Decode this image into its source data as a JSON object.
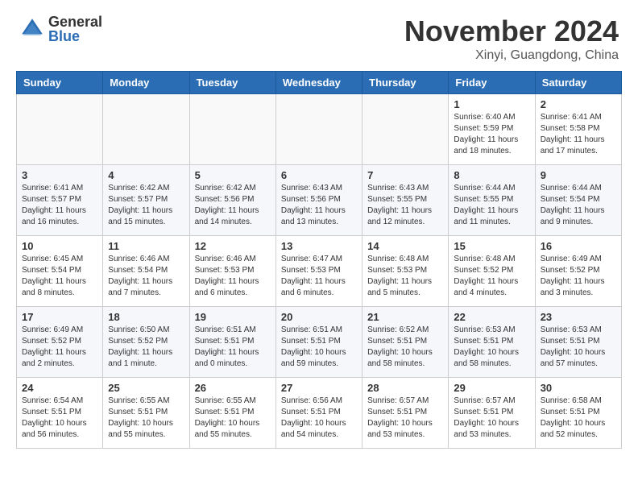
{
  "header": {
    "logo_general": "General",
    "logo_blue": "Blue",
    "month_title": "November 2024",
    "location": "Xinyi, Guangdong, China"
  },
  "weekdays": [
    "Sunday",
    "Monday",
    "Tuesday",
    "Wednesday",
    "Thursday",
    "Friday",
    "Saturday"
  ],
  "weeks": [
    [
      {
        "day": "",
        "info": ""
      },
      {
        "day": "",
        "info": ""
      },
      {
        "day": "",
        "info": ""
      },
      {
        "day": "",
        "info": ""
      },
      {
        "day": "",
        "info": ""
      },
      {
        "day": "1",
        "info": "Sunrise: 6:40 AM\nSunset: 5:59 PM\nDaylight: 11 hours and 18 minutes."
      },
      {
        "day": "2",
        "info": "Sunrise: 6:41 AM\nSunset: 5:58 PM\nDaylight: 11 hours and 17 minutes."
      }
    ],
    [
      {
        "day": "3",
        "info": "Sunrise: 6:41 AM\nSunset: 5:57 PM\nDaylight: 11 hours and 16 minutes."
      },
      {
        "day": "4",
        "info": "Sunrise: 6:42 AM\nSunset: 5:57 PM\nDaylight: 11 hours and 15 minutes."
      },
      {
        "day": "5",
        "info": "Sunrise: 6:42 AM\nSunset: 5:56 PM\nDaylight: 11 hours and 14 minutes."
      },
      {
        "day": "6",
        "info": "Sunrise: 6:43 AM\nSunset: 5:56 PM\nDaylight: 11 hours and 13 minutes."
      },
      {
        "day": "7",
        "info": "Sunrise: 6:43 AM\nSunset: 5:55 PM\nDaylight: 11 hours and 12 minutes."
      },
      {
        "day": "8",
        "info": "Sunrise: 6:44 AM\nSunset: 5:55 PM\nDaylight: 11 hours and 11 minutes."
      },
      {
        "day": "9",
        "info": "Sunrise: 6:44 AM\nSunset: 5:54 PM\nDaylight: 11 hours and 9 minutes."
      }
    ],
    [
      {
        "day": "10",
        "info": "Sunrise: 6:45 AM\nSunset: 5:54 PM\nDaylight: 11 hours and 8 minutes."
      },
      {
        "day": "11",
        "info": "Sunrise: 6:46 AM\nSunset: 5:54 PM\nDaylight: 11 hours and 7 minutes."
      },
      {
        "day": "12",
        "info": "Sunrise: 6:46 AM\nSunset: 5:53 PM\nDaylight: 11 hours and 6 minutes."
      },
      {
        "day": "13",
        "info": "Sunrise: 6:47 AM\nSunset: 5:53 PM\nDaylight: 11 hours and 6 minutes."
      },
      {
        "day": "14",
        "info": "Sunrise: 6:48 AM\nSunset: 5:53 PM\nDaylight: 11 hours and 5 minutes."
      },
      {
        "day": "15",
        "info": "Sunrise: 6:48 AM\nSunset: 5:52 PM\nDaylight: 11 hours and 4 minutes."
      },
      {
        "day": "16",
        "info": "Sunrise: 6:49 AM\nSunset: 5:52 PM\nDaylight: 11 hours and 3 minutes."
      }
    ],
    [
      {
        "day": "17",
        "info": "Sunrise: 6:49 AM\nSunset: 5:52 PM\nDaylight: 11 hours and 2 minutes."
      },
      {
        "day": "18",
        "info": "Sunrise: 6:50 AM\nSunset: 5:52 PM\nDaylight: 11 hours and 1 minute."
      },
      {
        "day": "19",
        "info": "Sunrise: 6:51 AM\nSunset: 5:51 PM\nDaylight: 11 hours and 0 minutes."
      },
      {
        "day": "20",
        "info": "Sunrise: 6:51 AM\nSunset: 5:51 PM\nDaylight: 10 hours and 59 minutes."
      },
      {
        "day": "21",
        "info": "Sunrise: 6:52 AM\nSunset: 5:51 PM\nDaylight: 10 hours and 58 minutes."
      },
      {
        "day": "22",
        "info": "Sunrise: 6:53 AM\nSunset: 5:51 PM\nDaylight: 10 hours and 58 minutes."
      },
      {
        "day": "23",
        "info": "Sunrise: 6:53 AM\nSunset: 5:51 PM\nDaylight: 10 hours and 57 minutes."
      }
    ],
    [
      {
        "day": "24",
        "info": "Sunrise: 6:54 AM\nSunset: 5:51 PM\nDaylight: 10 hours and 56 minutes."
      },
      {
        "day": "25",
        "info": "Sunrise: 6:55 AM\nSunset: 5:51 PM\nDaylight: 10 hours and 55 minutes."
      },
      {
        "day": "26",
        "info": "Sunrise: 6:55 AM\nSunset: 5:51 PM\nDaylight: 10 hours and 55 minutes."
      },
      {
        "day": "27",
        "info": "Sunrise: 6:56 AM\nSunset: 5:51 PM\nDaylight: 10 hours and 54 minutes."
      },
      {
        "day": "28",
        "info": "Sunrise: 6:57 AM\nSunset: 5:51 PM\nDaylight: 10 hours and 53 minutes."
      },
      {
        "day": "29",
        "info": "Sunrise: 6:57 AM\nSunset: 5:51 PM\nDaylight: 10 hours and 53 minutes."
      },
      {
        "day": "30",
        "info": "Sunrise: 6:58 AM\nSunset: 5:51 PM\nDaylight: 10 hours and 52 minutes."
      }
    ]
  ]
}
